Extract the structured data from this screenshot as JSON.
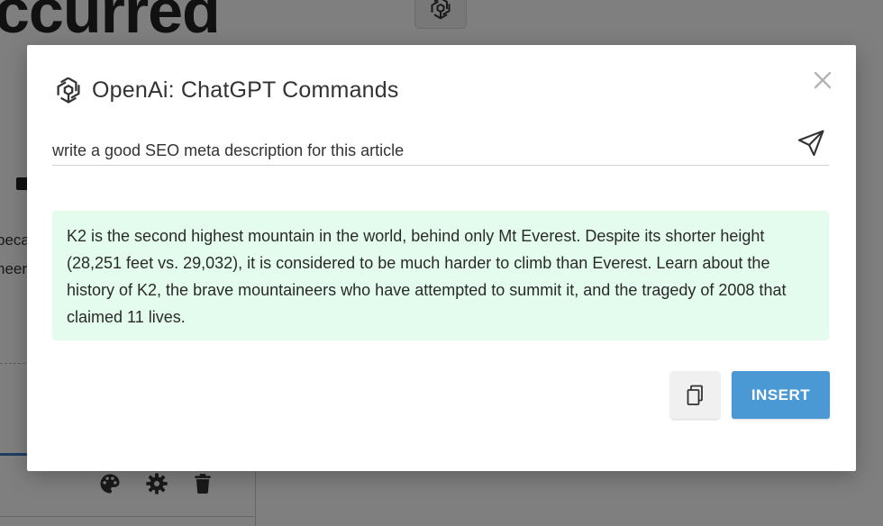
{
  "background": {
    "heading_fragment": "ccurred",
    "text_line_a": "peca",
    "text_line_b": "neer",
    "toolbar_icons": [
      "palette-icon",
      "gear-icon",
      "trash-icon"
    ]
  },
  "modal": {
    "title": "OpenAi: ChatGPT Commands",
    "logo_icon": "openai-logo-icon",
    "close_icon": "close-icon",
    "prompt": {
      "value": "write a good SEO meta description for this article",
      "placeholder": ""
    },
    "send_icon": "send-icon",
    "response": "K2 is the second highest mountain in the world, behind only Mt Everest. Despite its shorter height (28,251 feet vs. 29,032), it is considered to be much harder to climb than Everest. Learn about the history of K2, the brave mountaineers who have attempted to summit it, and the tragedy of 2008 that claimed 11 lives.",
    "copy_icon": "copy-icon",
    "insert_label": "INSERT"
  },
  "colors": {
    "response_bg": "#e3fcee",
    "insert_bg": "#4a98d4",
    "overlay": "rgba(0,0,0,0.5)"
  }
}
